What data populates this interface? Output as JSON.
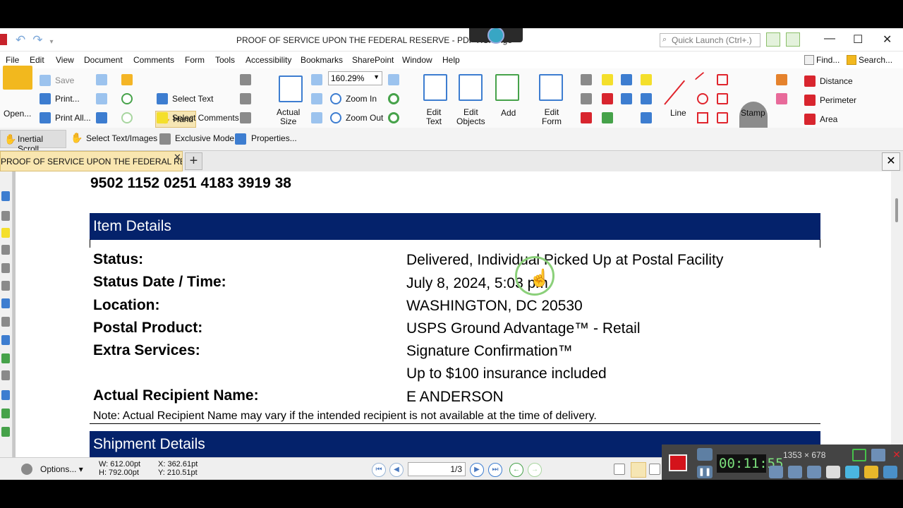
{
  "window": {
    "title": "PROOF OF SERVICE UPON THE FEDERAL RESERVE - PDF-XChange",
    "quick_launch_placeholder": "Quick Launch (Ctrl+.)"
  },
  "menu": [
    "File",
    "Edit",
    "View",
    "Document",
    "Comments",
    "Form",
    "Tools",
    "Accessibility",
    "Bookmarks",
    "SharePoint",
    "Window",
    "Help"
  ],
  "menu_right": {
    "find": "Find...",
    "search": "Search..."
  },
  "ribbon": {
    "open": "Open...",
    "save": "Save",
    "print": "Print...",
    "print_all": "Print All...",
    "hand": "Hand",
    "select_text": "Select Text",
    "select_comments": "Select Comments",
    "actual_size_1": "Actual",
    "actual_size_2": "Size",
    "zoom_value": "160.29%",
    "zoom_in": "Zoom In",
    "zoom_out": "Zoom Out",
    "edit_text_1": "Edit",
    "edit_text_2": "Text",
    "edit_objects_1": "Edit",
    "edit_objects_2": "Objects",
    "add": "Add",
    "edit_form_1": "Edit",
    "edit_form_2": "Form",
    "line": "Line",
    "stamp": "Stamp",
    "distance": "Distance",
    "perimeter": "Perimeter",
    "area": "Area"
  },
  "toolbar2": {
    "inertial_scroll": "Inertial Scroll",
    "select_text_images": "Select Text/Images",
    "exclusive_mode": "Exclusive Mode",
    "properties": "Properties..."
  },
  "tab": {
    "label": "PROOF OF SERVICE UPON THE FEDERAL RESERVE"
  },
  "document": {
    "tracking_number": "9502 1152 0251 4183 3919 38",
    "section_item_details": "Item Details",
    "rows": [
      {
        "label": "Status:",
        "value": "Delivered, Individual Picked Up at Postal Facility"
      },
      {
        "label": "Status Date / Time:",
        "value": "July 8, 2024, 5:03 pm"
      },
      {
        "label": "Location:",
        "value": "WASHINGTON, DC 20530"
      },
      {
        "label": "Postal Product:",
        "value": "USPS Ground Advantage™ - Retail"
      },
      {
        "label": "Extra Services:",
        "value": "Signature Confirmation™"
      },
      {
        "label": "",
        "value": "Up to $100 insurance included"
      },
      {
        "label": "Actual Recipient Name:",
        "value": "E ANDERSON"
      }
    ],
    "note": "Note: Actual Recipient Name may vary if the intended recipient is not available at the time of delivery.",
    "section_shipment_details": "Shipment Details"
  },
  "statusbar": {
    "options": "Options...",
    "w": "W: 612.00pt",
    "h": "H: 792.00pt",
    "x": "X: 362.61pt",
    "y": "Y: 210.51pt",
    "page": "1/3"
  },
  "recorder": {
    "time": "00:11:55",
    "resolution": "1353 × 678"
  }
}
